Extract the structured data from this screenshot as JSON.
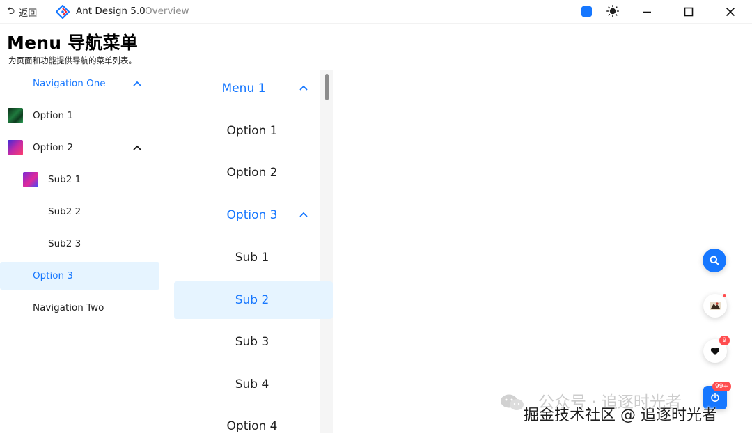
{
  "titlebar": {
    "back_label": "返回",
    "app_title": "Ant Design 5.0",
    "app_subtitle": "Overview",
    "accent_color": "#1677ff"
  },
  "page": {
    "title": "Menu 导航菜单",
    "description": "为页面和功能提供导航的菜单列表。"
  },
  "left_menu": {
    "items": [
      {
        "label": "Navigation One",
        "state": "expanded-active"
      },
      {
        "label": "Option 1",
        "icon": "image-thumbnail-icon"
      },
      {
        "label": "Option 2",
        "icon": "image-thumbnail-icon",
        "state": "expanded"
      },
      {
        "label": "Sub2 1",
        "icon": "image-thumbnail-icon"
      },
      {
        "label": "Sub2 2"
      },
      {
        "label": "Sub2 3"
      },
      {
        "label": "Option 3",
        "state": "selected"
      },
      {
        "label": "Navigation Two"
      }
    ]
  },
  "mid_menu": {
    "items": [
      {
        "label": "Menu 1",
        "state": "expanded-active"
      },
      {
        "label": "Option 1"
      },
      {
        "label": "Option 2"
      },
      {
        "label": "Option 3",
        "state": "expanded-active"
      },
      {
        "label": "Sub 1"
      },
      {
        "label": "Sub 2",
        "state": "selected"
      },
      {
        "label": "Sub 3"
      },
      {
        "label": "Sub 4"
      },
      {
        "label": "Option 4"
      }
    ]
  },
  "floating": {
    "heart_badge": "9",
    "power_badge": "99+"
  },
  "watermark": {
    "line1": "公众号 · 追逐时光者",
    "line2": "掘金技术社区 @ 追逐时光者"
  }
}
